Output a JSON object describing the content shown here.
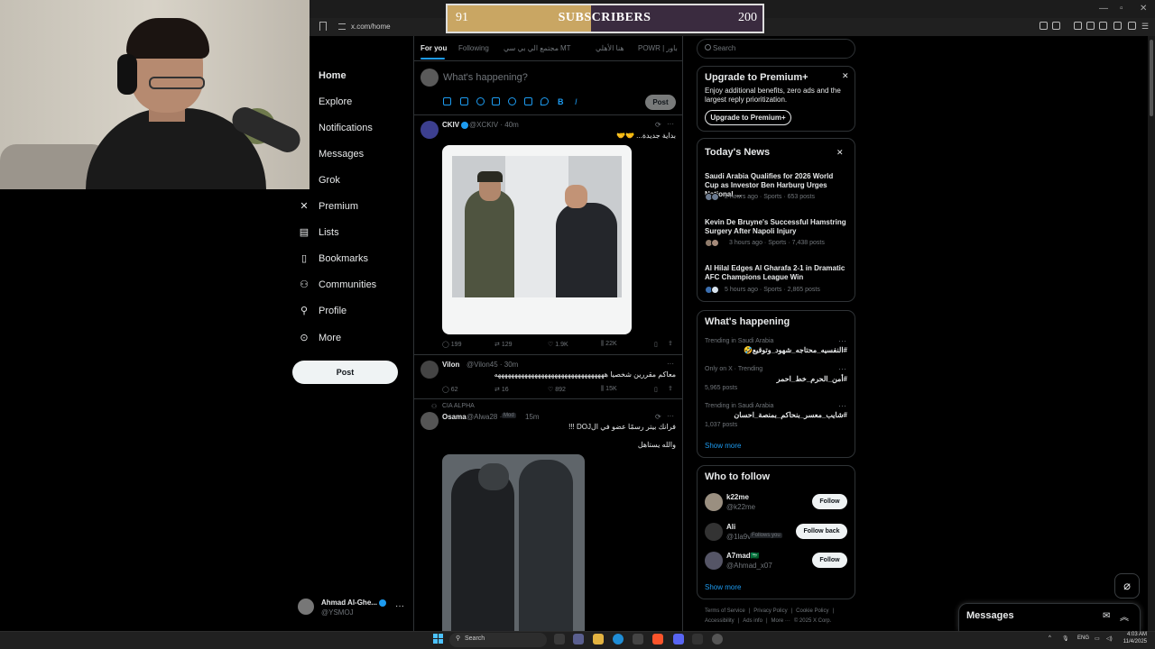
{
  "browser": {
    "url": "x.com/home",
    "win_controls": [
      "—",
      "▫",
      "✕"
    ]
  },
  "overlay": {
    "sub_left": "91",
    "sub_label": "SUBSCRIBERS",
    "sub_right": "200",
    "sub_progress": 0.455
  },
  "nav": {
    "items": [
      {
        "label": "Home",
        "icon": "home-icon"
      },
      {
        "label": "Explore",
        "icon": "search-icon"
      },
      {
        "label": "Notifications",
        "icon": "bell-icon"
      },
      {
        "label": "Messages",
        "icon": "mail-icon"
      },
      {
        "label": "Grok",
        "icon": "grok-icon"
      },
      {
        "label": "Premium",
        "icon": "x-icon"
      },
      {
        "label": "Lists",
        "icon": "list-icon"
      },
      {
        "label": "Bookmarks",
        "icon": "bookmark-icon"
      },
      {
        "label": "Communities",
        "icon": "people-icon"
      },
      {
        "label": "Profile",
        "icon": "person-icon"
      },
      {
        "label": "More",
        "icon": "more-circle-icon"
      }
    ],
    "post_label": "Post",
    "account": {
      "name": "Ahmad Al-Ghe...",
      "handle": "@YSMOJ",
      "more": "···"
    }
  },
  "tabs": [
    {
      "label": "For you"
    },
    {
      "label": "Following"
    },
    {
      "label": "مجتمع الي بي سي"
    },
    {
      "label": "MT"
    },
    {
      "label": "هنا الأهلي"
    },
    {
      "label": "POWR | باور"
    }
  ],
  "compose": {
    "placeholder": "What's happening?",
    "post_label": "Post",
    "bold": "B",
    "italic": "I"
  },
  "posts": [
    {
      "name": "CKIV",
      "meta": "@XCKIV · 40m",
      "text": "بداية جديدة... 🤝🤝",
      "more": "···",
      "stats": {
        "replies": "199",
        "reposts": "129",
        "likes": "1.9K",
        "views": "22K"
      }
    },
    {
      "name": "Vilon",
      "meta": "@Vilon45 · 30m",
      "text": "معاكم مقررين شخصيا هههههههههههههههههههههههههههههههههه",
      "more": "···",
      "stats": {
        "replies": "62",
        "reposts": "16",
        "likes": "892",
        "views": "15K"
      }
    },
    {
      "community": "CIA ALPHA",
      "name": "Osama",
      "handle": "@Alwa28 ·",
      "badge": "Mod",
      "time": "15m",
      "text": "فرانك بيتر رسمًا عضو في الDOJ !!!",
      "text2": "والله يستاهل",
      "more": "···"
    }
  ],
  "search_placeholder": "Search",
  "premium": {
    "title": "Upgrade to Premium+",
    "text": "Enjoy additional benefits, zero ads and the largest reply prioritization.",
    "button": "Upgrade to Premium+",
    "close": "✕"
  },
  "news": {
    "title": "Today's News",
    "close": "✕",
    "items": [
      {
        "title": "Saudi Arabia Qualifies for 2026 World Cup as Investor Ben Harburg Urges National ...",
        "meta": "2 hours ago · Sports · 653 posts"
      },
      {
        "title": "Kevin De Bruyne's Successful Hamstring Surgery After Napoli Injury",
        "meta": "3 hours ago · Sports · 7,438 posts"
      },
      {
        "title": "Al Hilal Edges Al Gharafa 2-1 in Dramatic AFC Champions League Win",
        "meta": "5 hours ago · Sports · 2,865 posts"
      }
    ]
  },
  "happening": {
    "title": "What's happening",
    "items": [
      {
        "meta": "Trending in Saudi Arabia",
        "title": "#النفسيه_محتاجه_شهود_وتوقيع🤣",
        "count": ""
      },
      {
        "meta": "Only on X · Trending",
        "title": "#أمن_الحرم_خط_احمر",
        "count": "5,965 posts"
      },
      {
        "meta": "Trending in Saudi Arabia",
        "title": "#شايب_معسر_بنحاكم_بمنصة_احسان",
        "count": "1,037 posts"
      }
    ],
    "show_more": "Show more"
  },
  "who_to_follow": {
    "title": "Who to follow",
    "items": [
      {
        "name": "k22me",
        "handle": "@k22me",
        "button": "Follow",
        "badge": ""
      },
      {
        "name": "Ali",
        "handle": "@1la9v",
        "button": "Follow back",
        "badge": "Follows you"
      },
      {
        "name": "A7mad🇸🇦",
        "handle": "@Ahmad_x07",
        "button": "Follow",
        "badge": ""
      }
    ],
    "show_more": "Show more"
  },
  "footer": {
    "line1": [
      "Terms of Service",
      "|",
      "Privacy Policy",
      "|",
      "Cookie Policy",
      "|"
    ],
    "line2": [
      "Accessibility",
      "|",
      "Ads info",
      "|",
      "More ···",
      "© 2025 X Corp."
    ]
  },
  "messages_drawer": {
    "label": "Messages"
  },
  "taskbar": {
    "search": "Search",
    "lang": "ENG",
    "time": "4:03 AM",
    "date": "11/4/2025"
  },
  "colors": {
    "accent": "#1d9bf0",
    "sub_fill": "#c9a663",
    "sub_bg": "#3a2b3f"
  }
}
